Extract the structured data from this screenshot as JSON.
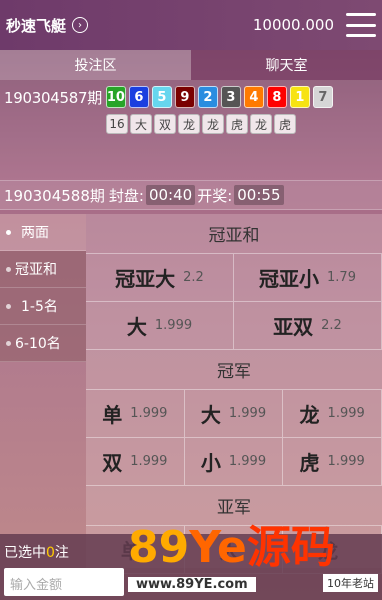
{
  "header": {
    "title": "秒速飞艇",
    "balance": "10000.000"
  },
  "tabs": [
    {
      "label": "投注区"
    },
    {
      "label": "聊天室"
    }
  ],
  "draw": {
    "period": "190304587期",
    "balls": [
      {
        "n": "10",
        "color": "#28a428"
      },
      {
        "n": "6",
        "color": "#1a3fe0"
      },
      {
        "n": "5",
        "color": "#66d6ee"
      },
      {
        "n": "9",
        "color": "#7a0000"
      },
      {
        "n": "2",
        "color": "#2a8de0"
      },
      {
        "n": "3",
        "color": "#555555"
      },
      {
        "n": "4",
        "color": "#ff7a00"
      },
      {
        "n": "8",
        "color": "#ff0000"
      },
      {
        "n": "1",
        "color": "#f7e312"
      },
      {
        "n": "7",
        "color": "#d6d6d6"
      }
    ],
    "sums": [
      "16",
      "大",
      "双",
      "龙",
      "龙",
      "虎",
      "龙",
      "虎"
    ]
  },
  "next": {
    "period": "190304588期",
    "close_label": "封盘:",
    "close_time": "00:40",
    "open_label": "开奖:",
    "open_time": "00:55"
  },
  "sidebar": [
    {
      "label": "两面"
    },
    {
      "label": "冠亚和"
    },
    {
      "label": "1-5名"
    },
    {
      "label": "6-10名"
    }
  ],
  "sections": {
    "s1": {
      "title": "冠亚和",
      "items": [
        {
          "name": "冠亚大",
          "odds": "2.2"
        },
        {
          "name": "冠亚小",
          "odds": "1.79"
        },
        {
          "name": "大",
          "odds": "1.999"
        },
        {
          "name": "亚双",
          "odds": "2.2"
        }
      ]
    },
    "s2": {
      "title": "冠军",
      "items": [
        {
          "name": "单",
          "odds": "1.999"
        },
        {
          "name": "大",
          "odds": "1.999"
        },
        {
          "name": "龙",
          "odds": "1.999"
        },
        {
          "name": "双",
          "odds": "1.999"
        },
        {
          "name": "小",
          "odds": "1.999"
        },
        {
          "name": "虎",
          "odds": "1.999"
        }
      ]
    },
    "s3": {
      "title": "亚军",
      "items": [
        {
          "name": "单",
          "odds": ""
        },
        {
          "name": "大",
          "odds": ""
        },
        {
          "name": "龙",
          "odds": ""
        }
      ]
    }
  },
  "bottom": {
    "selected_prefix": "已选中",
    "selected_count": "0",
    "selected_suffix": "注",
    "amount_placeholder": "输入金额"
  },
  "watermark": {
    "brand": "89Ye源码",
    "brand_1": "89",
    "brand_2": "Ye",
    "brand_3": "源码",
    "url": "www.89YE.com",
    "tag": "10年老站"
  }
}
